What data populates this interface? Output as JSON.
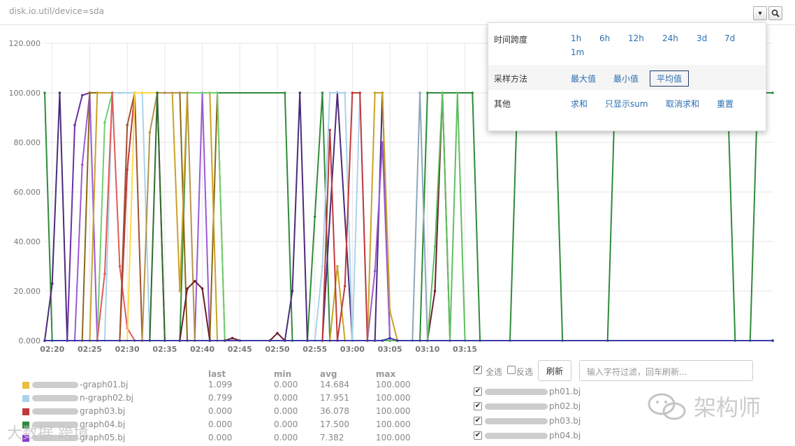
{
  "header": {
    "title": "disk.io.util/device=sda",
    "dropdown_glyph": "▾",
    "zoom_glyph": "⚲"
  },
  "popup": {
    "time_span_label": "时间跨度",
    "time_span_options": [
      "1h",
      "6h",
      "12h",
      "24h",
      "3d",
      "7d",
      "1m"
    ],
    "sampling_label": "采样方法",
    "sampling_options": [
      "最大值",
      "最小值",
      "平均值"
    ],
    "sampling_selected": "平均值",
    "other_label": "其他",
    "other_options": [
      "求和",
      "只显示sum",
      "取消求和",
      "重置"
    ]
  },
  "stats": {
    "headers": [
      "last",
      "min",
      "avg",
      "max"
    ],
    "rows": [
      {
        "name": "-graph01.bj",
        "color": "#e8c03c",
        "last": "1.099",
        "min": "0.000",
        "avg": "14.684",
        "max": "100.000"
      },
      {
        "name": "n-graph02.bj",
        "color": "#a9d3ea",
        "last": "0.799",
        "min": "0.000",
        "avg": "17.951",
        "max": "100.000"
      },
      {
        "name": "graph03.bj",
        "color": "#c0393b",
        "last": "0.000",
        "min": "0.000",
        "avg": "36.078",
        "max": "100.000"
      },
      {
        "name": "graph04.bj",
        "color": "#2e8b3a",
        "last": "0.000",
        "min": "0.000",
        "avg": "17.500",
        "max": "100.000"
      },
      {
        "name": "graph05.bj",
        "color": "#8a3fd1",
        "last": "0.000",
        "min": "0.000",
        "avg": "7.382",
        "max": "100.000"
      }
    ]
  },
  "filter": {
    "select_all": "全选",
    "invert": "反选",
    "refresh": "刷新",
    "placeholder": "输入字符过滤，回车刷新..."
  },
  "hosts": [
    {
      "name": "ph01.bj"
    },
    {
      "name": "ph02.bj"
    },
    {
      "name": "ph03.bj"
    },
    {
      "name": "ph04.bj"
    }
  ],
  "watermark": {
    "left": "大数据 跨境",
    "right": "架构师"
  },
  "colors": {
    "accent": "#2a6fb0",
    "selected_border": "#1f3a6e",
    "grid": "#e6e6e6",
    "axis_label": "#777777"
  },
  "chart_data": {
    "type": "line",
    "title": "",
    "xlabel": "",
    "ylabel": "",
    "ylim": [
      0,
      120
    ],
    "yticks": [
      "0.000",
      "20.000",
      "40.000",
      "60.000",
      "80.000",
      "100.000",
      "120.000"
    ],
    "yvalues": [
      0,
      20,
      40,
      60,
      80,
      100,
      120
    ],
    "xticks": [
      "02:20",
      "02:25",
      "02:30",
      "02:35",
      "02:40",
      "02:45",
      "02:50",
      "02:55",
      "03:00",
      "03:05",
      "03:10",
      "03:15"
    ],
    "xlim_min": [
      19,
      116
    ],
    "grid": true,
    "series": [
      {
        "color": "#2e8b3a",
        "points": [
          [
            19,
            100
          ],
          [
            20,
            0
          ],
          [
            37,
            0
          ],
          [
            38,
            100
          ],
          [
            51,
            100
          ],
          [
            52,
            0
          ],
          [
            54,
            0
          ],
          [
            55,
            50
          ],
          [
            56,
            100
          ],
          [
            57,
            0
          ],
          [
            69,
            0
          ],
          [
            70,
            100
          ],
          [
            76,
            100
          ],
          [
            77,
            0
          ],
          [
            81,
            0
          ],
          [
            82,
            100
          ],
          [
            87,
            100
          ],
          [
            88,
            0
          ],
          [
            94,
            0
          ],
          [
            95,
            100
          ],
          [
            110,
            100
          ],
          [
            111,
            0
          ],
          [
            113,
            0
          ],
          [
            114,
            100
          ],
          [
            116,
            100
          ]
        ]
      },
      {
        "color": "#4b2a7a",
        "points": [
          [
            19,
            0
          ],
          [
            20,
            23
          ],
          [
            21,
            100
          ],
          [
            22,
            0
          ],
          [
            38,
            0
          ],
          [
            39,
            0
          ],
          [
            51,
            0
          ],
          [
            52,
            20
          ],
          [
            53,
            100
          ],
          [
            54,
            0
          ],
          [
            56,
            0
          ],
          [
            58,
            100
          ],
          [
            60,
            0
          ],
          [
            63,
            0
          ],
          [
            64,
            100
          ],
          [
            65,
            0
          ],
          [
            116,
            0
          ]
        ]
      },
      {
        "color": "#6b2fa8",
        "points": [
          [
            19,
            0
          ],
          [
            22,
            0
          ],
          [
            23,
            87
          ],
          [
            24,
            99
          ],
          [
            25,
            100
          ],
          [
            26,
            100
          ]
        ]
      },
      {
        "color": "#9b59d6",
        "points": [
          [
            19,
            0
          ],
          [
            23,
            0
          ],
          [
            24,
            71
          ],
          [
            25,
            100
          ],
          [
            26,
            0
          ],
          [
            39,
            0
          ],
          [
            40,
            100
          ],
          [
            41,
            0
          ],
          [
            62,
            0
          ],
          [
            63,
            28
          ],
          [
            64,
            80
          ],
          [
            65,
            0
          ],
          [
            116,
            0
          ]
        ]
      },
      {
        "color": "#8b6914",
        "points": [
          [
            19,
            0
          ],
          [
            24,
            0
          ],
          [
            25,
            100
          ],
          [
            26,
            100
          ],
          [
            37,
            100
          ],
          [
            38,
            0
          ],
          [
            41,
            0
          ],
          [
            42,
            100
          ],
          [
            43,
            0
          ],
          [
            116,
            0
          ]
        ]
      },
      {
        "color": "#c9a227",
        "points": [
          [
            19,
            0
          ],
          [
            25,
            0
          ],
          [
            26,
            100
          ],
          [
            36,
            100
          ],
          [
            37,
            20
          ],
          [
            38,
            100
          ],
          [
            41,
            100
          ],
          [
            42,
            0
          ],
          [
            57,
            0
          ],
          [
            58,
            30
          ],
          [
            59,
            0
          ],
          [
            62,
            0
          ],
          [
            63,
            100
          ],
          [
            64,
            100
          ],
          [
            65,
            12
          ],
          [
            66,
            0
          ],
          [
            116,
            0
          ]
        ]
      },
      {
        "color": "#6fd06f",
        "points": [
          [
            19,
            0
          ],
          [
            26,
            0
          ],
          [
            27,
            88
          ],
          [
            28,
            100
          ],
          [
            42,
            100
          ],
          [
            43,
            0
          ],
          [
            116,
            0
          ]
        ]
      },
      {
        "color": "#a9d3ea",
        "points": [
          [
            19,
            0
          ],
          [
            26,
            0
          ],
          [
            27,
            0
          ],
          [
            28,
            100
          ],
          [
            29,
            100
          ],
          [
            31,
            100
          ],
          [
            32,
            100
          ],
          [
            33,
            0
          ],
          [
            55,
            0
          ],
          [
            56,
            30
          ],
          [
            57,
            100
          ],
          [
            59,
            100
          ],
          [
            60,
            0
          ],
          [
            61,
            100
          ],
          [
            62,
            0
          ],
          [
            116,
            0
          ]
        ]
      },
      {
        "color": "#e05a5a",
        "points": [
          [
            19,
            0
          ],
          [
            26,
            0
          ],
          [
            27,
            27
          ],
          [
            28,
            100
          ],
          [
            29,
            30
          ],
          [
            30,
            5
          ],
          [
            31,
            0
          ],
          [
            116,
            0
          ]
        ]
      },
      {
        "color": "#c0393b",
        "points": [
          [
            19,
            0
          ],
          [
            29,
            0
          ],
          [
            30,
            69
          ],
          [
            31,
            100
          ],
          [
            32,
            100
          ],
          [
            34,
            100
          ],
          [
            35,
            0
          ],
          [
            56,
            0
          ],
          [
            57,
            85
          ],
          [
            58,
            0
          ],
          [
            59,
            22
          ],
          [
            60,
            100
          ],
          [
            61,
            100
          ],
          [
            62,
            0
          ],
          [
            116,
            0
          ]
        ]
      },
      {
        "color": "#a0522d",
        "points": [
          [
            19,
            0
          ],
          [
            29,
            0
          ],
          [
            30,
            87
          ],
          [
            31,
            100
          ],
          [
            32,
            0
          ],
          [
            116,
            0
          ]
        ]
      },
      {
        "color": "#ffd84a",
        "points": [
          [
            19,
            0
          ],
          [
            30,
            0
          ],
          [
            31,
            100
          ],
          [
            32,
            100
          ],
          [
            34,
            100
          ]
        ]
      },
      {
        "color": "#b5934a",
        "points": [
          [
            19,
            0
          ],
          [
            32,
            0
          ],
          [
            33,
            84
          ],
          [
            34,
            100
          ],
          [
            35,
            100
          ],
          [
            38,
            100
          ],
          [
            39,
            0
          ],
          [
            116,
            0
          ]
        ]
      },
      {
        "color": "#2f6b2f",
        "points": [
          [
            19,
            0
          ],
          [
            33,
            0
          ],
          [
            34,
            100
          ],
          [
            35,
            0
          ],
          [
            116,
            0
          ]
        ]
      },
      {
        "color": "#6b1f2a",
        "points": [
          [
            19,
            0
          ],
          [
            37,
            0
          ],
          [
            38,
            21
          ],
          [
            39,
            24
          ],
          [
            40,
            21
          ],
          [
            41,
            0
          ],
          [
            43,
            0
          ],
          [
            44,
            1
          ],
          [
            45,
            0
          ],
          [
            49,
            0
          ],
          [
            50,
            3
          ],
          [
            51,
            0
          ],
          [
            70,
            0
          ],
          [
            71,
            20
          ],
          [
            72,
            100
          ],
          [
            73,
            0
          ],
          [
            116,
            0
          ]
        ]
      },
      {
        "color": "#8fa6b8",
        "points": [
          [
            19,
            0
          ],
          [
            68,
            0
          ],
          [
            69,
            100
          ],
          [
            70,
            0
          ],
          [
            116,
            0
          ]
        ]
      },
      {
        "color": "#5fbf5f",
        "points": [
          [
            19,
            0
          ],
          [
            70,
            0
          ],
          [
            71,
            38
          ],
          [
            72,
            100
          ],
          [
            73,
            0
          ],
          [
            74,
            100
          ],
          [
            75,
            0
          ],
          [
            116,
            0
          ]
        ]
      },
      {
        "color": "#3a3aa8",
        "points": [
          [
            19,
            0
          ],
          [
            64,
            0
          ],
          [
            65,
            1
          ],
          [
            66,
            0
          ],
          [
            116,
            0
          ]
        ]
      }
    ]
  }
}
